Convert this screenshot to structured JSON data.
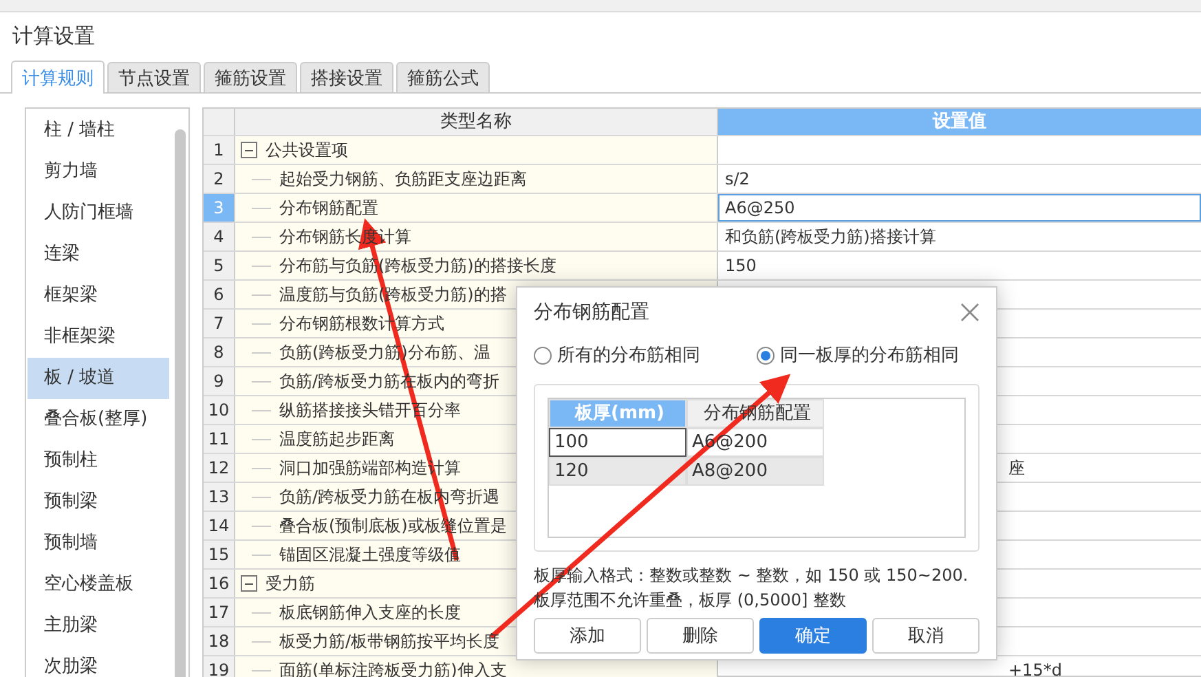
{
  "window": {
    "title": "计算设置"
  },
  "tabs": [
    {
      "label": "计算规则",
      "selected": true
    },
    {
      "label": "节点设置",
      "selected": false
    },
    {
      "label": "箍筋设置",
      "selected": false
    },
    {
      "label": "搭接设置",
      "selected": false
    },
    {
      "label": "箍筋公式",
      "selected": false
    }
  ],
  "sidebar": {
    "items": [
      {
        "label": "柱 / 墙柱",
        "selected": false
      },
      {
        "label": "剪力墙",
        "selected": false
      },
      {
        "label": "人防门框墙",
        "selected": false
      },
      {
        "label": "连梁",
        "selected": false
      },
      {
        "label": "框架梁",
        "selected": false
      },
      {
        "label": "非框架梁",
        "selected": false
      },
      {
        "label": "板 / 坡道",
        "selected": true
      },
      {
        "label": "叠合板(整厚)",
        "selected": false
      },
      {
        "label": "预制柱",
        "selected": false
      },
      {
        "label": "预制梁",
        "selected": false
      },
      {
        "label": "预制墙",
        "selected": false
      },
      {
        "label": "空心楼盖板",
        "selected": false
      },
      {
        "label": "主肋梁",
        "selected": false
      },
      {
        "label": "次肋梁",
        "selected": false
      }
    ]
  },
  "table": {
    "columns": [
      "类型名称",
      "设置值"
    ],
    "groups": [
      {
        "number": "1",
        "name": "公共设置项",
        "expanded": true,
        "children": [
          {
            "number": "2",
            "name": "起始受力钢筋、负筋距支座边距离",
            "value": "s/2",
            "selected": false
          },
          {
            "number": "3",
            "name": "分布钢筋配置",
            "value": "A6@250",
            "selected": true
          },
          {
            "number": "4",
            "name": "分布钢筋长度计算",
            "value": "和负筋(跨板受力筋)搭接计算",
            "selected": false
          },
          {
            "number": "5",
            "name": "分布筋与负筋(跨板受力筋)的搭接长度",
            "value": "150",
            "selected": false
          },
          {
            "number": "6",
            "name": "温度筋与负筋(跨板受力筋)的搭",
            "selected": false
          },
          {
            "number": "7",
            "name": "分布钢筋根数计算方式",
            "selected": false
          },
          {
            "number": "8",
            "name": "负筋(跨板受力筋)分布筋、温",
            "selected": false
          },
          {
            "number": "9",
            "name": "负筋/跨板受力筋在板内的弯折",
            "selected": false
          },
          {
            "number": "10",
            "name": "纵筋搭接接头错开百分率",
            "selected": false
          },
          {
            "number": "11",
            "name": "温度筋起步距离",
            "selected": false
          },
          {
            "number": "12",
            "name": "洞口加强筋端部构造计算",
            "value": "座",
            "kind": "covered",
            "selected": false
          },
          {
            "number": "13",
            "name": "负筋/跨板受力筋在板内弯折遇",
            "selected": false
          },
          {
            "number": "14",
            "name": "叠合板(预制底板)或板缝位置是",
            "selected": false
          },
          {
            "number": "15",
            "name": "锚固区混凝土强度等级值",
            "selected": false
          }
        ]
      },
      {
        "number": "16",
        "name": "受力筋",
        "expanded": true,
        "children": [
          {
            "number": "17",
            "name": "板底钢筋伸入支座的长度",
            "selected": false
          },
          {
            "number": "18",
            "name": "板受力筋/板带钢筋按平均长度",
            "selected": false
          },
          {
            "number": "19",
            "name": "面筋(单标注跨板受力筋)伸入支",
            "value": "+15*d",
            "kind": "covered",
            "selected": false
          }
        ]
      }
    ]
  },
  "dialog": {
    "title": "分布钢筋配置",
    "options": [
      {
        "label": "所有的分布筋相同",
        "selected": false
      },
      {
        "label": "同一板厚的分布筋相同",
        "selected": true
      }
    ],
    "columns": [
      {
        "label": "板厚(mm)",
        "selected": true
      },
      {
        "label": "分布钢筋配置",
        "selected": false
      }
    ],
    "rows": [
      {
        "thickness": "100",
        "config": "A6@200",
        "selected": false
      },
      {
        "thickness": "120",
        "config": "A8@200",
        "selected": true
      }
    ],
    "hint": [
      "板厚输入格式：整数或整数 ~ 整数，如 150 或 150~200.",
      "板厚范围不允许重叠，板厚 (0,5000] 整数"
    ],
    "buttons": [
      {
        "label": "添加",
        "kind": "plain"
      },
      {
        "label": "删除",
        "kind": "plain"
      },
      {
        "label": "确定",
        "kind": "primary"
      },
      {
        "label": "取消",
        "kind": "plain"
      }
    ]
  }
}
